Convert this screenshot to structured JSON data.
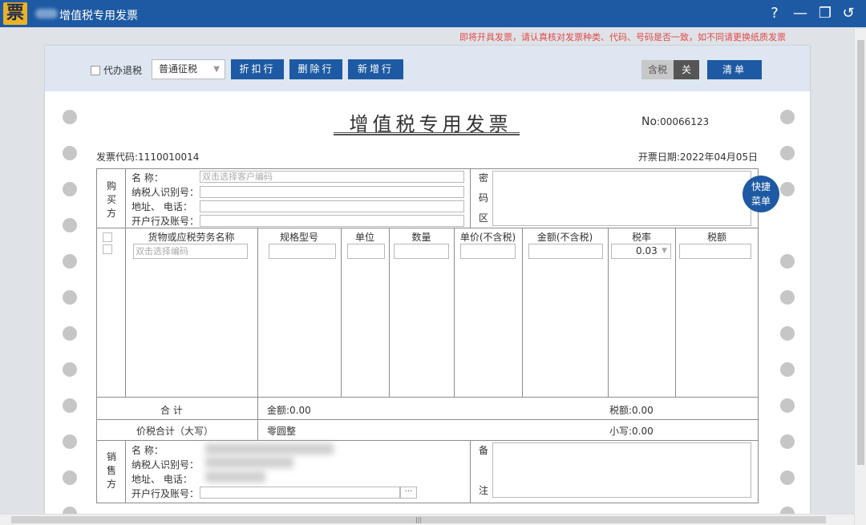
{
  "app": {
    "logo": "票",
    "title": "增值税专用发票",
    "help": "?",
    "minimize": "—",
    "restore": "❐",
    "back": "↺"
  },
  "warning": "即将开具发票，请认真核对发票种类、代码、号码是否一致，如不同请更换纸质发票",
  "toolbar": {
    "agent_refund": "代办退税",
    "tax_type": "普通征税",
    "discount_row": "折扣行",
    "delete_row": "删除行",
    "add_row": "新增行",
    "tax_included": "含税",
    "tax_toggle": "关",
    "list": "清单"
  },
  "invoice": {
    "title": "增值税专用发票",
    "no_label": "No",
    "no_value": ":00066123",
    "code": "发票代码:1110010014",
    "date": "开票日期:2022年04月05日",
    "buyer_label": [
      "购",
      "买",
      "方"
    ],
    "buyer": {
      "name_label": "名        称：",
      "name_placeholder": "双击选择客户编码",
      "taxid_label": "纳税人识别号：",
      "address_label": "地址、   电话：",
      "bank_label": "开户行及账号："
    },
    "secret_label": [
      "密",
      "码",
      "区"
    ],
    "columns": {
      "goods": "货物或应税劳务名称",
      "spec": "规格型号",
      "unit": "单位",
      "qty": "数量",
      "price": "单价(不含税)",
      "amount": "金额(不含税)",
      "rate": "税率",
      "tax": "税额"
    },
    "goods_placeholder": "双击选择编码",
    "rate_value": "0.03",
    "total_label": "合    计",
    "total_amount": "金额:0.00",
    "total_tax": "税额:0.00",
    "grand_label": "价税合计（大写）",
    "grand_upper": "零圆整",
    "grand_lower": "小写:0.00",
    "seller_label": [
      "销",
      "售",
      "方"
    ],
    "seller": {
      "name_label": "名        称：",
      "taxid_label": "纳税人识别号：",
      "address_label": "地址、   电话：",
      "bank_label": "开户行及账号：",
      "bank_btn": "···"
    },
    "remark_label": [
      "备",
      "注"
    ]
  },
  "quick_menu": "快捷菜单",
  "hscroll_grip": "|||"
}
